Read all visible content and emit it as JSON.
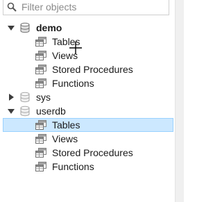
{
  "search": {
    "placeholder": "Filter objects"
  },
  "tree": {
    "schemas": [
      {
        "name": "demo",
        "expanded": true,
        "active": true,
        "children": [
          "Tables",
          "Views",
          "Stored Procedures",
          "Functions"
        ]
      },
      {
        "name": "sys",
        "expanded": false,
        "active": false,
        "children": []
      },
      {
        "name": "userdb",
        "expanded": true,
        "active": false,
        "children": [
          "Tables",
          "Views",
          "Stored Procedures",
          "Functions"
        ],
        "selected_child": "Tables"
      }
    ]
  },
  "icons": {
    "search": "search-icon",
    "schema": "database-icon",
    "group": "table-group-icon",
    "expanded": "triangle-down-icon",
    "collapsed": "triangle-right-icon",
    "cursor": "move-cursor-icon"
  },
  "colors": {
    "selection": "#cce8ff",
    "selection_border": "#99d1ff",
    "toggle": "#3c3c3c"
  }
}
